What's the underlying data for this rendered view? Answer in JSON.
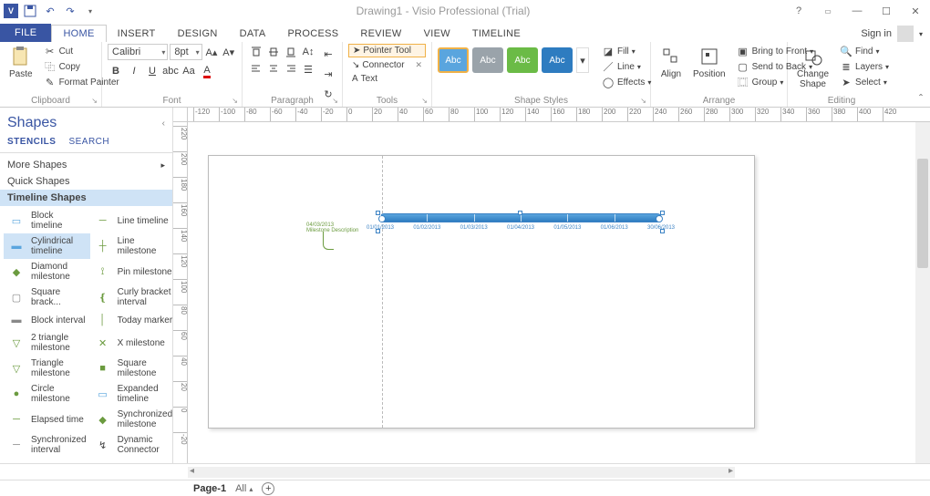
{
  "title": "Drawing1 - Visio Professional (Trial)",
  "signin": "Sign in",
  "tabs": [
    "FILE",
    "HOME",
    "INSERT",
    "DESIGN",
    "DATA",
    "PROCESS",
    "REVIEW",
    "VIEW",
    "TIMELINE"
  ],
  "active_tab": "HOME",
  "clipboard": {
    "paste": "Paste",
    "cut": "Cut",
    "copy": "Copy",
    "format_painter": "Format Painter",
    "label": "Clipboard"
  },
  "font": {
    "name": "Calibri",
    "size": "8pt",
    "label": "Font"
  },
  "paragraph": {
    "label": "Paragraph"
  },
  "tools": {
    "pointer": "Pointer Tool",
    "connector": "Connector",
    "text": "Text",
    "label": "Tools"
  },
  "shape_styles": {
    "abc": "Abc",
    "fill": "Fill",
    "line": "Line",
    "effects": "Effects",
    "label": "Shape Styles",
    "swatches": [
      "#5aa5de",
      "#9aa3aa",
      "#6bbb46",
      "#2e7cc0"
    ]
  },
  "arrange": {
    "align": "Align",
    "position": "Position",
    "bring_front": "Bring to Front",
    "send_back": "Send to Back",
    "group": "Group",
    "label": "Arrange"
  },
  "editing": {
    "change_shape": "Change\nShape",
    "find": "Find",
    "layers": "Layers",
    "select": "Select",
    "label": "Editing"
  },
  "shapes_pane": {
    "title": "Shapes",
    "tabs": [
      "STENCILS",
      "SEARCH"
    ],
    "more": "More Shapes",
    "quick": "Quick Shapes",
    "stencil": "Timeline Shapes",
    "items": [
      "Block timeline",
      "Line timeline",
      "Cylindrical timeline",
      "Line milestone",
      "Diamond milestone",
      "Pin milestone",
      "Square brack...",
      "Curly bracket interval",
      "Block interval",
      "Today marker",
      "2 triangle milestone",
      "X milestone",
      "Triangle milestone",
      "Square milestone",
      "Circle milestone",
      "Expanded timeline",
      "Elapsed time",
      "Synchronized milestone",
      "Synchronized interval",
      "Dynamic Connector"
    ]
  },
  "ruler_h": [
    -120,
    -100,
    -80,
    -60,
    -40,
    -20,
    0,
    20,
    40,
    60,
    80,
    100,
    120,
    140,
    160,
    180,
    200,
    220,
    240,
    260,
    280,
    300,
    320,
    340,
    360,
    380,
    400,
    420
  ],
  "ruler_v": [
    220,
    200,
    180,
    160,
    140,
    120,
    100,
    80,
    60,
    40,
    20,
    0,
    -20
  ],
  "timeline_dates": [
    "01/01/2013",
    "01/02/2013",
    "01/03/2013",
    "01/04/2013",
    "01/05/2013",
    "01/06/2013",
    "30/06/2013"
  ],
  "annotation": "04/03/2013\nMilestone Description",
  "pagebar": {
    "page": "Page-1",
    "all": "All"
  }
}
